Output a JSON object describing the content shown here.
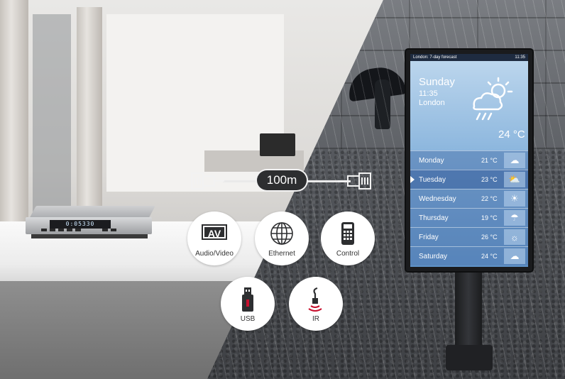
{
  "device": {
    "display": "0:05330"
  },
  "cable": {
    "distance_label": "100m"
  },
  "features": [
    {
      "label": "Audio/Video",
      "badge": "AV",
      "icon": "av-icon"
    },
    {
      "label": "Ethernet",
      "icon": "globe-icon"
    },
    {
      "label": "Control",
      "icon": "remote-control-icon"
    },
    {
      "label": "USB",
      "icon": "usb-drive-icon"
    },
    {
      "label": "IR",
      "icon": "ir-sensor-icon"
    }
  ],
  "signage": {
    "header_title": "London: 7-day forecast",
    "header_time": "11:35",
    "current": {
      "day": "Sunday",
      "time": "11:35",
      "city": "London",
      "temp": "24 °C",
      "icon": "rain-sun-cloud-icon"
    },
    "forecast": [
      {
        "day": "Monday",
        "temp": "21 °C",
        "icon": "cloud-icon"
      },
      {
        "day": "Tuesday",
        "temp": "23 °C",
        "icon": "partly-sunny-icon"
      },
      {
        "day": "Wednesday",
        "temp": "22 °C",
        "icon": "sun-rain-icon"
      },
      {
        "day": "Thursday",
        "temp": "19 °C",
        "icon": "rain-cloud-icon"
      },
      {
        "day": "Friday",
        "temp": "26 °C",
        "icon": "sun-icon"
      },
      {
        "day": "Saturday",
        "temp": "24 °C",
        "icon": "drizzle-icon"
      }
    ]
  },
  "colors": {
    "label_pill": "#2d2e30",
    "screen_top": "#bfd8ee",
    "screen_bottom": "#5f93c8"
  }
}
